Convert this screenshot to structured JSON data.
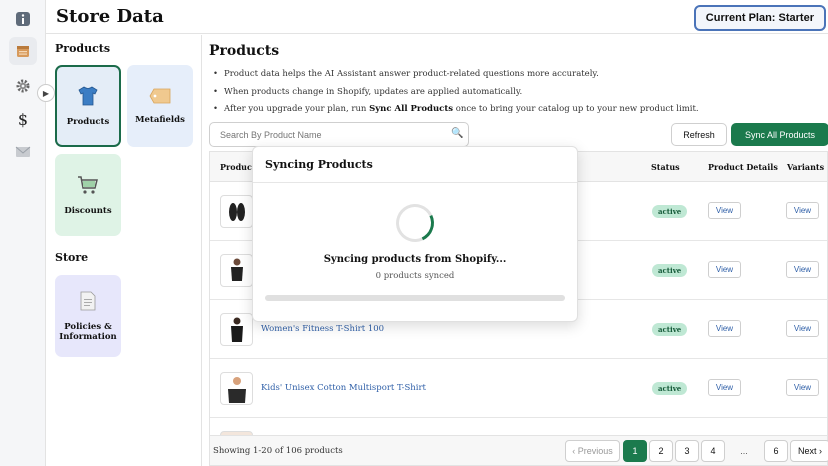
{
  "header": {
    "title": "Store Data",
    "plan_label": "Current Plan: Starter"
  },
  "rail": {
    "icons": [
      "info-icon",
      "database-icon",
      "gear-icon",
      "dollar-icon",
      "mail-icon"
    ]
  },
  "categories": {
    "products_heading": "Products",
    "store_heading": "Store",
    "cards": [
      {
        "label": "Products",
        "icon": "tshirt-icon"
      },
      {
        "label": "Metafields",
        "icon": "tag-icon"
      },
      {
        "label": "Discounts",
        "icon": "cart-icon"
      },
      {
        "label": "Policies & Information",
        "icon": "document-icon"
      }
    ]
  },
  "main": {
    "title": "Products",
    "notes": [
      "Product data helps the AI Assistant answer product-related questions more accurately.",
      "When products change in Shopify, updates are applied automatically."
    ],
    "note3_pre": "After you upgrade your plan, run ",
    "note3_bold": "Sync All Products",
    "note3_post": " once to bring your catalog up to your new product limit.",
    "search_placeholder": "Search By Product Name",
    "refresh_label": "Refresh",
    "sync_label": "Sync All Products"
  },
  "table": {
    "columns": [
      "Product",
      "Status",
      "Product Details",
      "Variants"
    ],
    "rows": [
      {
        "name": "",
        "status": "active",
        "details": "View",
        "variants": "View"
      },
      {
        "name": "",
        "status": "active",
        "details": "View",
        "variants": "View"
      },
      {
        "name": "Women's Fitness T-Shirt 100",
        "status": "active",
        "details": "View",
        "variants": "View"
      },
      {
        "name": "Kids' Unisex Cotton Multisport T-Shirt",
        "status": "active",
        "details": "View",
        "variants": "View"
      }
    ]
  },
  "pagination": {
    "showing": "Showing 1-20 of 106 products",
    "prev": "‹ Previous",
    "pages": [
      "1",
      "2",
      "3",
      "4"
    ],
    "ellipsis": "...",
    "last": "6",
    "next": "Next ›",
    "current": "1"
  },
  "modal": {
    "title": "Syncing Products",
    "message": "Syncing products from Shopify...",
    "count": "0 products synced",
    "progress": 0
  },
  "colors": {
    "accent": "#1b7a4d",
    "badge_bg": "#bfe8d4",
    "link": "#3060a8"
  }
}
